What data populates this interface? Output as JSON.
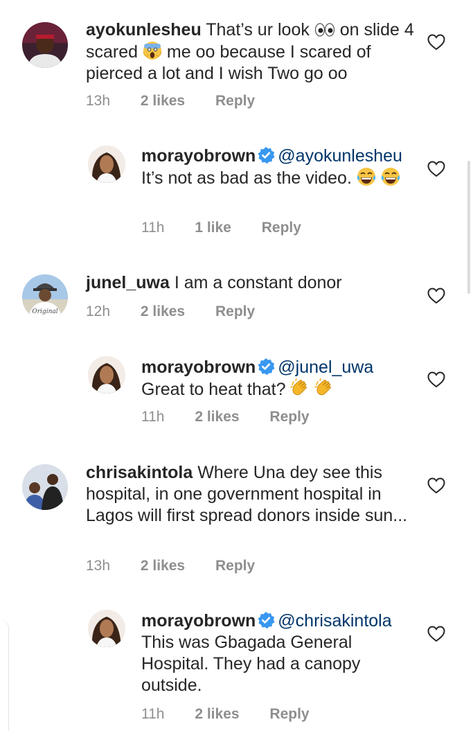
{
  "comments": [
    {
      "username": "ayokunlesheu",
      "text_a": "That’s ur look ",
      "text_b": " on slide 4 scared ",
      "text_c": " me oo because I scared of pierced a lot and I wish Two go oo",
      "time": "13h",
      "likes": "2 likes",
      "reply_label": "Reply"
    },
    {
      "username": "morayobrown",
      "mention": "@ayokunlesheu",
      "text_a": "It’s not as bad as the video. ",
      "time": "11h",
      "likes": "1 like",
      "reply_label": "Reply"
    },
    {
      "username": "junel_uwa",
      "text_a": "I am a constant donor",
      "time": "12h",
      "likes": "2 likes",
      "reply_label": "Reply"
    },
    {
      "username": "morayobrown",
      "mention": "@junel_uwa",
      "text_a": "Great to heat that? ",
      "time": "11h",
      "likes": "2 likes",
      "reply_label": "Reply"
    },
    {
      "username": "chrisakintola",
      "text_a": "Where Una dey see this hospital, in one government hospital in Lagos will first spread donors inside sun...",
      "time": "13h",
      "likes": "2 likes",
      "reply_label": "Reply"
    },
    {
      "username": "morayobrown",
      "mention": "@chrisakintola",
      "text_a": "This was Gbagada General Hospital. They had a canopy outside.",
      "time": "11h",
      "likes": "2 likes",
      "reply_label": "Reply"
    }
  ],
  "icons": {
    "like": "heart-outline-icon",
    "verified": "verified-badge-icon"
  },
  "colors": {
    "text": "#262626",
    "meta": "#8e8e8e",
    "mention": "#003569",
    "verified": "#3897f0"
  }
}
